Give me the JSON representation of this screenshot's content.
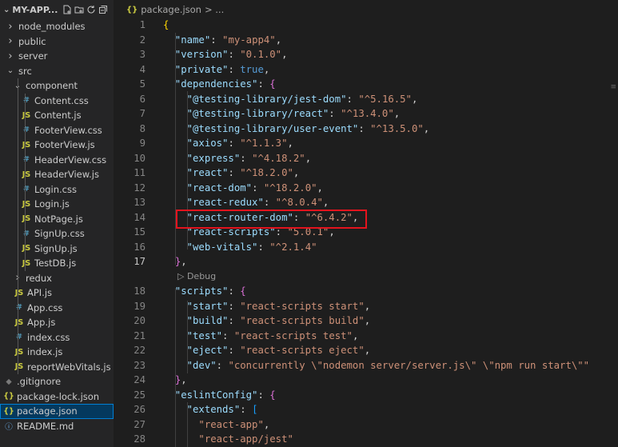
{
  "explorer": {
    "title": "MY-APP...",
    "header_icons": [
      "new-file-icon",
      "new-folder-icon",
      "refresh-icon",
      "collapse-all-icon"
    ],
    "items": [
      {
        "label": "node_modules",
        "kind": "folder",
        "expanded": false,
        "depth": 0
      },
      {
        "label": "public",
        "kind": "folder",
        "expanded": false,
        "depth": 0
      },
      {
        "label": "server",
        "kind": "folder",
        "expanded": false,
        "depth": 0
      },
      {
        "label": "src",
        "kind": "folder",
        "expanded": true,
        "depth": 0
      },
      {
        "label": "component",
        "kind": "folder",
        "expanded": true,
        "depth": 1
      },
      {
        "label": "Content.css",
        "kind": "css",
        "depth": 2
      },
      {
        "label": "Content.js",
        "kind": "js",
        "depth": 2
      },
      {
        "label": "FooterView.css",
        "kind": "css",
        "depth": 2
      },
      {
        "label": "FooterView.js",
        "kind": "js",
        "depth": 2
      },
      {
        "label": "HeaderView.css",
        "kind": "css",
        "depth": 2
      },
      {
        "label": "HeaderView.js",
        "kind": "js",
        "depth": 2
      },
      {
        "label": "Login.css",
        "kind": "css",
        "depth": 2
      },
      {
        "label": "Login.js",
        "kind": "js",
        "depth": 2
      },
      {
        "label": "NotPage.js",
        "kind": "js",
        "depth": 2
      },
      {
        "label": "SignUp.css",
        "kind": "css",
        "depth": 2
      },
      {
        "label": "SignUp.js",
        "kind": "js",
        "depth": 2
      },
      {
        "label": "TestDB.js",
        "kind": "js",
        "depth": 2
      },
      {
        "label": "redux",
        "kind": "folder",
        "expanded": false,
        "depth": 1
      },
      {
        "label": "API.js",
        "kind": "js",
        "depth": 1
      },
      {
        "label": "App.css",
        "kind": "css",
        "depth": 1
      },
      {
        "label": "App.js",
        "kind": "js",
        "depth": 1
      },
      {
        "label": "index.css",
        "kind": "css",
        "depth": 1
      },
      {
        "label": "index.js",
        "kind": "js",
        "depth": 1
      },
      {
        "label": "reportWebVitals.js",
        "kind": "js",
        "depth": 1
      },
      {
        "label": ".gitignore",
        "kind": "git",
        "depth": 0
      },
      {
        "label": "package-lock.json",
        "kind": "json",
        "depth": 0
      },
      {
        "label": "package.json",
        "kind": "json",
        "depth": 0,
        "selected": true
      },
      {
        "label": "README.md",
        "kind": "info",
        "depth": 0
      }
    ]
  },
  "breadcrumb": {
    "icon": "{}",
    "file": "package.json",
    "sep": "> ..."
  },
  "codelens": "▷ Debug",
  "code_lines": [
    {
      "n": "1",
      "t": [
        [
          "{",
          "br1"
        ]
      ]
    },
    {
      "n": "2",
      "t": [
        [
          "  \"name\"",
          "k"
        ],
        [
          ": ",
          "p"
        ],
        [
          "\"my-app4\"",
          "s"
        ],
        [
          ",",
          "p"
        ]
      ]
    },
    {
      "n": "3",
      "t": [
        [
          "  \"version\"",
          "k"
        ],
        [
          ": ",
          "p"
        ],
        [
          "\"0.1.0\"",
          "s"
        ],
        [
          ",",
          "p"
        ]
      ]
    },
    {
      "n": "4",
      "t": [
        [
          "  \"private\"",
          "k"
        ],
        [
          ": ",
          "p"
        ],
        [
          "true",
          "b"
        ],
        [
          ",",
          "p"
        ]
      ]
    },
    {
      "n": "5",
      "t": [
        [
          "  \"dependencies\"",
          "k"
        ],
        [
          ": ",
          "p"
        ],
        [
          "{",
          "br2"
        ]
      ]
    },
    {
      "n": "6",
      "t": [
        [
          "    \"@testing-library/jest-dom\"",
          "k"
        ],
        [
          ": ",
          "p"
        ],
        [
          "\"^5.16.5\"",
          "s"
        ],
        [
          ",",
          "p"
        ]
      ]
    },
    {
      "n": "7",
      "t": [
        [
          "    \"@testing-library/react\"",
          "k"
        ],
        [
          ": ",
          "p"
        ],
        [
          "\"^13.4.0\"",
          "s"
        ],
        [
          ",",
          "p"
        ]
      ]
    },
    {
      "n": "8",
      "t": [
        [
          "    \"@testing-library/user-event\"",
          "k"
        ],
        [
          ": ",
          "p"
        ],
        [
          "\"^13.5.0\"",
          "s"
        ],
        [
          ",",
          "p"
        ]
      ]
    },
    {
      "n": "9",
      "t": [
        [
          "    \"axios\"",
          "k"
        ],
        [
          ": ",
          "p"
        ],
        [
          "\"^1.1.3\"",
          "s"
        ],
        [
          ",",
          "p"
        ]
      ]
    },
    {
      "n": "10",
      "t": [
        [
          "    \"express\"",
          "k"
        ],
        [
          ": ",
          "p"
        ],
        [
          "\"^4.18.2\"",
          "s"
        ],
        [
          ",",
          "p"
        ]
      ]
    },
    {
      "n": "11",
      "t": [
        [
          "    \"react\"",
          "k"
        ],
        [
          ": ",
          "p"
        ],
        [
          "\"^18.2.0\"",
          "s"
        ],
        [
          ",",
          "p"
        ]
      ]
    },
    {
      "n": "12",
      "t": [
        [
          "    \"react-dom\"",
          "k"
        ],
        [
          ": ",
          "p"
        ],
        [
          "\"^18.2.0\"",
          "s"
        ],
        [
          ",",
          "p"
        ]
      ]
    },
    {
      "n": "13",
      "t": [
        [
          "    \"react-redux\"",
          "k"
        ],
        [
          ": ",
          "p"
        ],
        [
          "\"^8.0.4\"",
          "s"
        ],
        [
          ",",
          "p"
        ]
      ]
    },
    {
      "n": "14",
      "t": [
        [
          "    \"react-router-dom\"",
          "k"
        ],
        [
          ": ",
          "p"
        ],
        [
          "\"^6.4.2\"",
          "s"
        ],
        [
          ",",
          "p"
        ]
      ]
    },
    {
      "n": "15",
      "t": [
        [
          "    \"react-scripts\"",
          "k"
        ],
        [
          ": ",
          "p"
        ],
        [
          "\"5.0.1\"",
          "s"
        ],
        [
          ",",
          "p"
        ]
      ]
    },
    {
      "n": "16",
      "t": [
        [
          "    \"web-vitals\"",
          "k"
        ],
        [
          ": ",
          "p"
        ],
        [
          "\"^2.1.4\"",
          "s"
        ]
      ]
    },
    {
      "n": "17",
      "t": [
        [
          "  ",
          "p"
        ],
        [
          "}",
          "br2"
        ],
        [
          ",",
          "p"
        ]
      ],
      "current": true
    },
    {
      "codelens": true
    },
    {
      "n": "18",
      "t": [
        [
          "  \"scripts\"",
          "k"
        ],
        [
          ": ",
          "p"
        ],
        [
          "{",
          "br2"
        ]
      ]
    },
    {
      "n": "19",
      "t": [
        [
          "    \"start\"",
          "k"
        ],
        [
          ": ",
          "p"
        ],
        [
          "\"react-scripts start\"",
          "s"
        ],
        [
          ",",
          "p"
        ]
      ]
    },
    {
      "n": "20",
      "t": [
        [
          "    \"build\"",
          "k"
        ],
        [
          ": ",
          "p"
        ],
        [
          "\"react-scripts build\"",
          "s"
        ],
        [
          ",",
          "p"
        ]
      ]
    },
    {
      "n": "21",
      "t": [
        [
          "    \"test\"",
          "k"
        ],
        [
          ": ",
          "p"
        ],
        [
          "\"react-scripts test\"",
          "s"
        ],
        [
          ",",
          "p"
        ]
      ]
    },
    {
      "n": "22",
      "t": [
        [
          "    \"eject\"",
          "k"
        ],
        [
          ": ",
          "p"
        ],
        [
          "\"react-scripts eject\"",
          "s"
        ],
        [
          ",",
          "p"
        ]
      ]
    },
    {
      "n": "23",
      "t": [
        [
          "    \"dev\"",
          "k"
        ],
        [
          ": ",
          "p"
        ],
        [
          "\"concurrently \\\"nodemon server/server.js\\\" \\\"npm run start\\\"\"",
          "s"
        ]
      ]
    },
    {
      "n": "24",
      "t": [
        [
          "  ",
          "p"
        ],
        [
          "}",
          "br2"
        ],
        [
          ",",
          "p"
        ]
      ]
    },
    {
      "n": "25",
      "t": [
        [
          "  \"eslintConfig\"",
          "k"
        ],
        [
          ": ",
          "p"
        ],
        [
          "{",
          "br2"
        ]
      ]
    },
    {
      "n": "26",
      "t": [
        [
          "    \"extends\"",
          "k"
        ],
        [
          ": ",
          "p"
        ],
        [
          "[",
          "br3"
        ]
      ]
    },
    {
      "n": "27",
      "t": [
        [
          "      \"react-app\"",
          "s"
        ],
        [
          ",",
          "p"
        ]
      ]
    },
    {
      "n": "28",
      "t": [
        [
          "      \"react-app/jest\"",
          "s"
        ]
      ]
    }
  ]
}
